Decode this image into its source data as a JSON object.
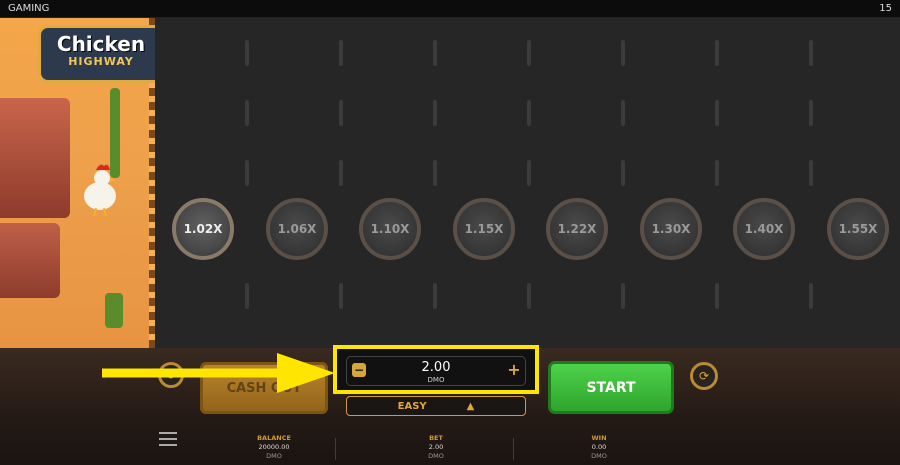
{
  "topbar": {
    "title": "GAMING",
    "count": "15"
  },
  "logo": {
    "line1": "Chicken",
    "line2": "HIGHWAY"
  },
  "multipliers": [
    "1.02X",
    "1.06X",
    "1.10X",
    "1.15X",
    "1.22X",
    "1.30X",
    "1.40X",
    "1.55X"
  ],
  "active_multiplier_index": 0,
  "controls": {
    "cashout_label": "CASH OUT",
    "bet_value": "2.00",
    "bet_currency": "DMO",
    "difficulty": "EASY",
    "start_label": "START"
  },
  "stats": {
    "balance": {
      "label": "BALANCE",
      "value": "20000.00",
      "currency": "DMO"
    },
    "bet": {
      "label": "BET",
      "value": "2.00",
      "currency": "DMO"
    },
    "win": {
      "label": "WIN",
      "value": "0.00",
      "currency": "DMO"
    }
  },
  "colors": {
    "highlight": "#ffe600",
    "start": "#3cbf3a",
    "gold": "#d6a63d"
  },
  "icons": [
    "undo-icon",
    "autoplay-icon",
    "minus-icon",
    "plus-icon",
    "menu-icon",
    "arrow-up-icon"
  ]
}
